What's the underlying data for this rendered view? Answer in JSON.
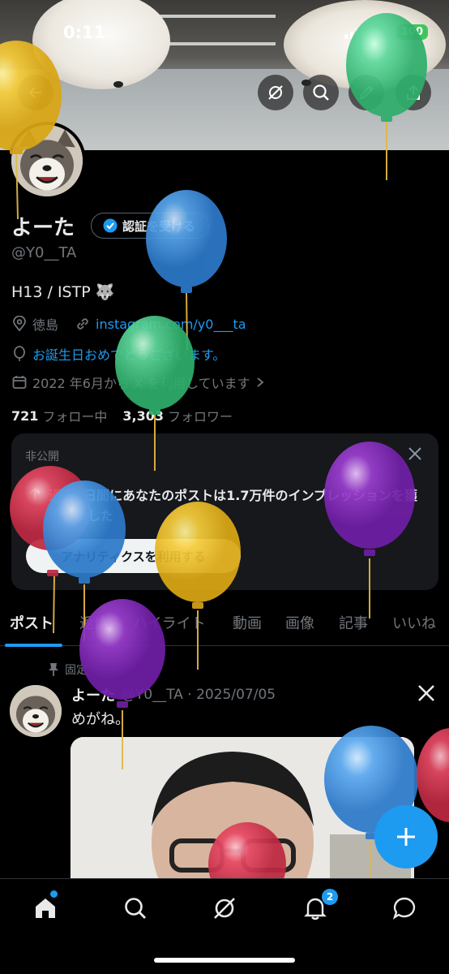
{
  "status_bar": {
    "time": "0:11",
    "battery": "100"
  },
  "profile": {
    "display_name": "よーた",
    "verify_button_label": "認証を受ける",
    "handle": "@Y0__TA",
    "bio": "H13 / ISTP 🐺",
    "location": "徳島",
    "website": "instagram.com/y0___ta",
    "birthday": "お誕生日おめでとうございます。",
    "joined": "2022 年6月から X を利用しています",
    "following_count": "721",
    "following_label": "フォロー中",
    "followers_count": "3,303",
    "followers_label": "フォロワー"
  },
  "analytics_card": {
    "label": "非公開",
    "message": "過去7日間にあなたのポストは1.7万件のインプレッションを獲得しました",
    "button_label": "アナリティクスを利用する"
  },
  "tabs": [
    "ポスト",
    "返信",
    "ハイライト",
    "動画",
    "画像",
    "記事",
    "いいね"
  ],
  "pinned_post": {
    "pinned_label": "固定",
    "author": "よーた",
    "meta": "@Y0__TA · 2025/07/05",
    "text": "めがね。"
  },
  "bottom_nav": {
    "notifications_badge": "2"
  },
  "colors": {
    "accent": "#1d9bf0",
    "background": "#000000",
    "card": "#16181c",
    "muted": "#71767b"
  },
  "icons": [
    "back-icon",
    "grok-icon",
    "search-icon",
    "edit-icon",
    "share-icon",
    "verified-icon",
    "location-icon",
    "link-icon",
    "balloon-icon",
    "calendar-icon",
    "close-icon",
    "pin-icon",
    "x-logo-icon",
    "compose-icon",
    "home-icon",
    "notifications-icon",
    "messages-icon"
  ]
}
